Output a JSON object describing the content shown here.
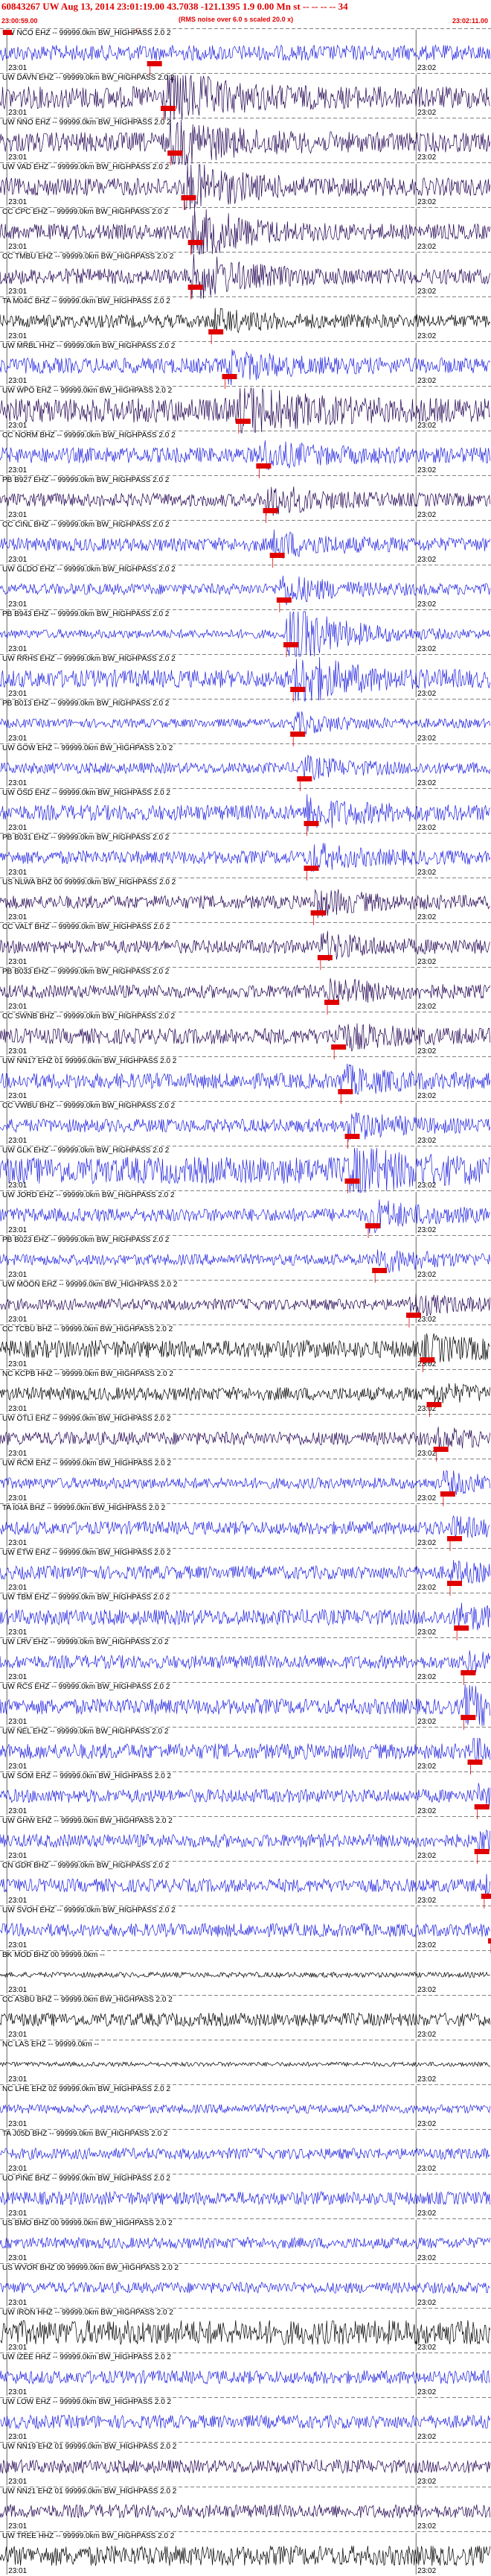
{
  "header": {
    "title": "60843267 UW Aug 13, 2014 23:01:19.00    43.7038 -121.1395  1.9 0.00 Mn st -- -- -- -- 34",
    "start_time": "23:00:59.00",
    "note": "(RMS noise over 6.0 s scaled 20.0 x)",
    "end_time": "23:02:11.00"
  },
  "colors": {
    "event_marker": "#e00000",
    "pick_line": "#e00000",
    "trace_palette": [
      "#2020e0",
      "#200050",
      "#000000"
    ],
    "grid": "#000000"
  },
  "chart_data": {
    "type": "line",
    "title": "60843267 UW Aug 13, 2014 23:01:19.00    43.7038 -121.1395  1.9 0.00 Mn st -- -- -- -- 34",
    "xlim": [
      "23:00:59.00",
      "23:02:11.00"
    ],
    "minute_ticks": [
      "23:01",
      "23:02"
    ],
    "event_time": "23:01:19.00",
    "traces": [
      {
        "label": "UW NCO EHZ -- 99999.0km BW_HIGHPASS  2.0  2",
        "tick1": "23:01",
        "tick2": "23:02",
        "color": "blue",
        "amplitude": 0.35,
        "p_pick": "23:01:21",
        "burst": 0
      },
      {
        "label": "UW DAVN EHZ -- 99999.0km BW_HIGHPASS  2.0  2",
        "tick1": "23:01",
        "tick2": "23:02",
        "color": "dark",
        "amplitude": 0.5,
        "p_pick": "23:01:23",
        "burst": 2.4
      },
      {
        "label": "UW NNO EHZ -- 99999.0km BW_HIGHPASS  2.0  2",
        "tick1": "23:01",
        "tick2": "23:02",
        "color": "dark",
        "amplitude": 0.45,
        "p_pick": "23:01:24",
        "burst": 2.0
      },
      {
        "label": "UW VAD EHZ -- 99999.0km BW_HIGHPASS  2.0  2",
        "tick1": "23:01",
        "tick2": "23:02",
        "color": "dark",
        "amplitude": 0.4,
        "p_pick": "23:01:26",
        "burst": 2.2
      },
      {
        "label": "CC CPC EHZ -- 99999.0km BW_HIGHPASS  2.0  2",
        "tick1": "23:01",
        "tick2": "23:02",
        "color": "dark",
        "amplitude": 0.35,
        "p_pick": "23:01:27",
        "burst": 2.4
      },
      {
        "label": "CC TMBU EHZ -- 99999.0km BW_HIGHPASS  2.0  2",
        "tick1": "23:01",
        "tick2": "23:02",
        "color": "dark",
        "amplitude": 0.35,
        "p_pick": "23:01:27",
        "burst": 2.0
      },
      {
        "label": "TA M04C BHZ -- 99999.0km BW_HIGHPASS  2.0  2",
        "tick1": "23:01",
        "tick2": "23:02",
        "color": "black",
        "amplitude": 0.3,
        "p_pick": "23:01:30",
        "burst": 0.8
      },
      {
        "label": "UW MRBL HHZ -- 99999.0km BW_HIGHPASS  2.0  2",
        "tick1": "23:01",
        "tick2": "23:02",
        "color": "blue",
        "amplitude": 0.35,
        "p_pick": "23:01:32",
        "burst": 1.2
      },
      {
        "label": "UW WPO EHZ -- 99999.0km BW_HIGHPASS  2.0  2",
        "tick1": "23:01",
        "tick2": "23:02",
        "color": "dark",
        "amplitude": 0.55,
        "p_pick": "23:01:34",
        "burst": 2.0
      },
      {
        "label": "CC NORM BHZ -- 99999.0km BW_HIGHPASS  2.0  2",
        "tick1": "23:01",
        "tick2": "23:02",
        "color": "blue",
        "amplitude": 0.35,
        "p_pick": "23:01:37",
        "burst": 1.0
      },
      {
        "label": "PB B927 EHZ -- 99999.0km BW_HIGHPASS  2.0  2",
        "tick1": "23:01",
        "tick2": "23:02",
        "color": "dark",
        "amplitude": 0.3,
        "p_pick": "23:01:38",
        "burst": 1.2
      },
      {
        "label": "CC CINL BHZ -- 99999.0km BW_HIGHPASS  2.0  2",
        "tick1": "23:01",
        "tick2": "23:02",
        "color": "blue",
        "amplitude": 0.3,
        "p_pick": "23:01:39",
        "burst": 1.0
      },
      {
        "label": "UW GLDO EHZ -- 99999.0km BW_HIGHPASS  2.0  2",
        "tick1": "23:01",
        "tick2": "23:02",
        "color": "blue",
        "amplitude": 0.25,
        "p_pick": "23:01:40",
        "burst": 1.2
      },
      {
        "label": "PB B943 EHZ -- 99999.0km BW_HIGHPASS  2.0  2",
        "tick1": "23:01",
        "tick2": "23:02",
        "color": "blue",
        "amplitude": 0.2,
        "p_pick": "23:01:41",
        "burst": 3.2
      },
      {
        "label": "UW RRHS EHZ -- 99999.0km BW_HIGHPASS  2.0  2",
        "tick1": "23:01",
        "tick2": "23:02",
        "color": "blue",
        "amplitude": 0.4,
        "p_pick": "23:01:42",
        "burst": 2.2
      },
      {
        "label": "PB B013 EHZ -- 99999.0km BW_HIGHPASS  2.0  2",
        "tick1": "23:01",
        "tick2": "23:02",
        "color": "blue",
        "amplitude": 0.2,
        "p_pick": "23:01:42",
        "burst": 0.8
      },
      {
        "label": "UW GOW EHZ -- 99999.0km BW_HIGHPASS  2.0  2",
        "tick1": "23:01",
        "tick2": "23:02",
        "color": "blue",
        "amplitude": 0.25,
        "p_pick": "23:01:43",
        "burst": 0.8
      },
      {
        "label": "UW OSD EHZ -- 99999.0km BW_HIGHPASS  2.0  2",
        "tick1": "23:01",
        "tick2": "23:02",
        "color": "blue",
        "amplitude": 0.35,
        "p_pick": "23:01:44",
        "burst": 1.2
      },
      {
        "label": "PB B031 EHZ -- 99999.0km BW_HIGHPASS  2.0  2",
        "tick1": "23:01",
        "tick2": "23:02",
        "color": "blue",
        "amplitude": 0.3,
        "p_pick": "23:01:44",
        "burst": 1.0
      },
      {
        "label": "US NLWA BHZ 00 99999.0km BW_HIGHPASS  2.0  2",
        "tick1": "23:01",
        "tick2": "23:02",
        "color": "dark",
        "amplitude": 0.3,
        "p_pick": "23:01:45",
        "burst": 1.0
      },
      {
        "label": "CC VALT BHZ -- 99999.0km BW_HIGHPASS  2.0  2",
        "tick1": "23:01",
        "tick2": "23:02",
        "color": "dark",
        "amplitude": 0.3,
        "p_pick": "23:01:46",
        "burst": 1.0
      },
      {
        "label": "PB B033 EHZ -- 99999.0km BW_HIGHPASS  2.0  2",
        "tick1": "23:01",
        "tick2": "23:02",
        "color": "dark",
        "amplitude": 0.3,
        "p_pick": "23:01:47",
        "burst": 1.0
      },
      {
        "label": "CC SWNB BHZ -- 99999.0km BW_HIGHPASS  2.0  2",
        "tick1": "23:01",
        "tick2": "23:02",
        "color": "dark",
        "amplitude": 0.35,
        "p_pick": "23:01:48",
        "burst": 1.0
      },
      {
        "label": "UW NN17 EHZ 01 99999.0km BW_HIGHPASS  2.0  2",
        "tick1": "23:01",
        "tick2": "23:02",
        "color": "blue",
        "amplitude": 0.35,
        "p_pick": "23:01:49",
        "burst": 1.0
      },
      {
        "label": "CC VWBU BHZ -- 99999.0km BW_HIGHPASS  2.0  2",
        "tick1": "23:01",
        "tick2": "23:02",
        "color": "blue",
        "amplitude": 0.3,
        "p_pick": "23:01:50",
        "burst": 1.0
      },
      {
        "label": "UW GLK EHZ -- 99999.0km BW_HIGHPASS  2.0  2",
        "tick1": "23:01",
        "tick2": "23:02",
        "color": "blue",
        "amplitude": 0.6,
        "p_pick": "23:01:50",
        "burst": 1.8
      },
      {
        "label": "UW JORD EHZ -- 99999.0km BW_HIGHPASS  2.0  2",
        "tick1": "23:01",
        "tick2": "23:02",
        "color": "blue",
        "amplitude": 0.3,
        "p_pick": "23:01:53",
        "burst": 1.2
      },
      {
        "label": "PB B023 EHZ -- 99999.0km BW_HIGHPASS  2.0  2",
        "tick1": "23:01",
        "tick2": "23:02",
        "color": "blue",
        "amplitude": 0.25,
        "p_pick": "23:01:54",
        "burst": 1.0
      },
      {
        "label": "UW MOON EHZ -- 99999.0km BW_HIGHPASS  2.0  2",
        "tick1": "23:01",
        "tick2": "23:02",
        "color": "dark",
        "amplitude": 0.25,
        "p_pick": "23:01:59",
        "burst": 0.8
      },
      {
        "label": "CC TCBU BHZ -- 99999.0km BW_HIGHPASS  2.0  2",
        "tick1": "23:01",
        "tick2": "23:02",
        "color": "black",
        "amplitude": 0.4,
        "p_pick": "23:02:01",
        "burst": 0.8
      },
      {
        "label": "NC KCPB HHZ -- 99999.0km BW_HIGHPASS  2.0  2",
        "tick1": "23:01",
        "tick2": "23:02",
        "color": "black",
        "amplitude": 0.3,
        "p_pick": "23:02:02",
        "burst": 0.6
      },
      {
        "label": "UW OTLI EHZ -- 99999.0km BW_HIGHPASS  2.0  2",
        "tick1": "23:01",
        "tick2": "23:02",
        "color": "dark",
        "amplitude": 0.3,
        "p_pick": "23:02:03",
        "burst": 0.6
      },
      {
        "label": "UW RCM EHZ -- 99999.0km BW_HIGHPASS  2.0  2",
        "tick1": "23:01",
        "tick2": "23:02",
        "color": "blue",
        "amplitude": 0.25,
        "p_pick": "23:02:04",
        "burst": 0.8
      },
      {
        "label": "TA I04A BHZ -- 99999.0km BW_HIGHPASS  2.0  2",
        "tick1": "23:01",
        "tick2": "23:02",
        "color": "blue",
        "amplitude": 0.3,
        "p_pick": "23:02:05",
        "burst": 0.6
      },
      {
        "label": "UW ETW EHZ -- 99999.0km BW_HIGHPASS  2.0  2",
        "tick1": "23:01",
        "tick2": "23:02",
        "color": "blue",
        "amplitude": 0.3,
        "p_pick": "23:02:05",
        "burst": 0.6
      },
      {
        "label": "UW TBM EHZ -- 99999.0km BW_HIGHPASS  2.0  2",
        "tick1": "23:01",
        "tick2": "23:02",
        "color": "blue",
        "amplitude": 0.35,
        "p_pick": "23:02:06",
        "burst": 0.8
      },
      {
        "label": "UW LRV EHZ -- 99999.0km BW_HIGHPASS  2.0  2",
        "tick1": "23:01",
        "tick2": "23:02",
        "color": "blue",
        "amplitude": 0.3,
        "p_pick": "23:02:07",
        "burst": 0.6
      },
      {
        "label": "UW RCS EHZ -- 99999.0km BW_HIGHPASS  2.0  2",
        "tick1": "23:01",
        "tick2": "23:02",
        "color": "blue",
        "amplitude": 0.35,
        "p_pick": "23:02:07",
        "burst": 1.6
      },
      {
        "label": "UW NEL EHZ -- 99999.0km BW_HIGHPASS  2.0  2",
        "tick1": "23:01",
        "tick2": "23:02",
        "color": "blue",
        "amplitude": 0.35,
        "p_pick": "23:02:08",
        "burst": 0.6
      },
      {
        "label": "UW SOM EHZ -- 99999.0km BW_HIGHPASS  2.0  2",
        "tick1": "23:01",
        "tick2": "23:02",
        "color": "blue",
        "amplitude": 0.3,
        "p_pick": "23:02:09",
        "burst": 0.6
      },
      {
        "label": "UW GHW EHZ -- 99999.0km BW_HIGHPASS  2.0  2",
        "tick1": "23:01",
        "tick2": "23:02",
        "color": "blue",
        "amplitude": 0.3,
        "p_pick": "23:02:09",
        "burst": 0.6
      },
      {
        "label": "CN GDR BHZ -- 99999.0km BW_HIGHPASS  2.0  2",
        "tick1": "23:01",
        "tick2": "23:02",
        "color": "blue",
        "amplitude": 0.3,
        "p_pick": "23:02:10",
        "burst": 0.6
      },
      {
        "label": "UW SVOH EHZ -- 99999.0km BW_HIGHPASS  2.0  2",
        "tick1": "23:01",
        "tick2": "23:02",
        "color": "blue",
        "amplitude": 0.3,
        "p_pick": "23:02:11",
        "burst": 0.6
      },
      {
        "label": "BK MOD BHZ 00 99999.0km --",
        "tick1": "23:01",
        "tick2": "23:02",
        "color": "black",
        "amplitude": 0.12,
        "p_pick": "",
        "burst": 0
      },
      {
        "label": "CC ASBU BHZ -- 99999.0km BW_HIGHPASS  2.0  2",
        "tick1": "23:01",
        "tick2": "23:02",
        "color": "black",
        "amplitude": 0.3,
        "p_pick": "",
        "burst": 0
      },
      {
        "label": "NC LAS EHZ -- 99999.0km --",
        "tick1": "23:01",
        "tick2": "23:02",
        "color": "black",
        "amplitude": 0.1,
        "p_pick": "",
        "burst": 0
      },
      {
        "label": "NC LHE EHZ 02 99999.0km BW_HIGHPASS  2.0  2",
        "tick1": "23:01",
        "tick2": "23:02",
        "color": "blue",
        "amplitude": 0.2,
        "p_pick": "",
        "burst": 0
      },
      {
        "label": "TA J05D BHZ -- 99999.0km BW_HIGHPASS  2.0  2",
        "tick1": "23:01",
        "tick2": "23:02",
        "color": "blue",
        "amplitude": 0.25,
        "p_pick": "",
        "burst": 0.5
      },
      {
        "label": "UO PINE BHZ -- 99999.0km BW_HIGHPASS  2.0  2",
        "tick1": "23:01",
        "tick2": "23:02",
        "color": "blue",
        "amplitude": 0.3,
        "p_pick": "",
        "burst": 0
      },
      {
        "label": "US BMO BHZ 00 99999.0km BW_HIGHPASS  2.0  2",
        "tick1": "23:01",
        "tick2": "23:02",
        "color": "blue",
        "amplitude": 0.25,
        "p_pick": "",
        "burst": 0
      },
      {
        "label": "US WVOR BHZ 00 99999.0km BW_HIGHPASS  2.0  2",
        "tick1": "23:01",
        "tick2": "23:02",
        "color": "blue",
        "amplitude": 0.25,
        "p_pick": "",
        "burst": 0
      },
      {
        "label": "UW IRON HHZ -- 99999.0km BW_HIGHPASS  2.0  2",
        "tick1": "23:01",
        "tick2": "23:02",
        "color": "black",
        "amplitude": 0.55,
        "p_pick": "",
        "burst": 0
      },
      {
        "label": "UW IZEE HHZ -- 99999.0km BW_HIGHPASS  2.0  2",
        "tick1": "23:01",
        "tick2": "23:02",
        "color": "blue",
        "amplitude": 0.3,
        "p_pick": "",
        "burst": 0
      },
      {
        "label": "UW LOW EHZ -- 99999.0km BW_HIGHPASS  2.0  2",
        "tick1": "23:01",
        "tick2": "23:02",
        "color": "blue",
        "amplitude": 0.3,
        "p_pick": "",
        "burst": 0
      },
      {
        "label": "UW NN19 EHZ 01 99999.0km BW_HIGHPASS  2.0  2",
        "tick1": "23:01",
        "tick2": "23:02",
        "color": "dark",
        "amplitude": 0.3,
        "p_pick": "",
        "burst": 0
      },
      {
        "label": "UW NN21 EHZ 01 99999.0km BW_HIGHPASS  2.0  2",
        "tick1": "23:01",
        "tick2": "23:02",
        "color": "dark",
        "amplitude": 0.3,
        "p_pick": "",
        "burst": 0
      },
      {
        "label": "UW TREE HHZ -- 99999.0km BW_HIGHPASS  2.0  2",
        "tick1": "23:01",
        "tick2": "23:02",
        "color": "black",
        "amplitude": 0.45,
        "p_pick": "",
        "burst": 0
      }
    ]
  }
}
